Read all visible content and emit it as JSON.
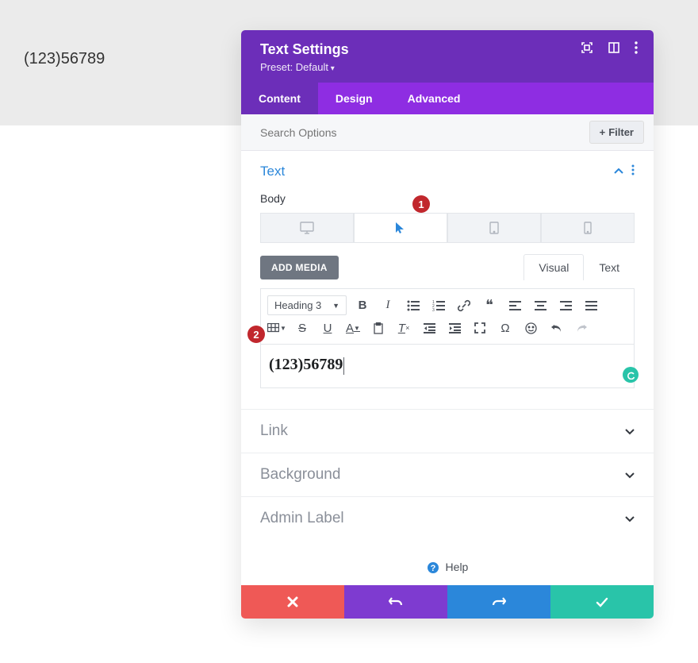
{
  "page": {
    "preview_text": "(123)56789"
  },
  "modal": {
    "title": "Text Settings",
    "preset_label": "Preset: Default",
    "tabs": {
      "content": "Content",
      "design": "Design",
      "advanced": "Advanced"
    },
    "search_placeholder": "Search Options",
    "filter_label": "Filter"
  },
  "sections": {
    "text": {
      "title": "Text",
      "body_label": "Body"
    },
    "link": {
      "title": "Link"
    },
    "background": {
      "title": "Background"
    },
    "admin": {
      "title": "Admin Label"
    }
  },
  "editor": {
    "add_media": "ADD MEDIA",
    "visual_tab": "Visual",
    "text_tab": "Text",
    "format_select": "Heading 3",
    "content": "(123)56789"
  },
  "help": {
    "label": "Help"
  },
  "callouts": {
    "one": "1",
    "two": "2"
  }
}
